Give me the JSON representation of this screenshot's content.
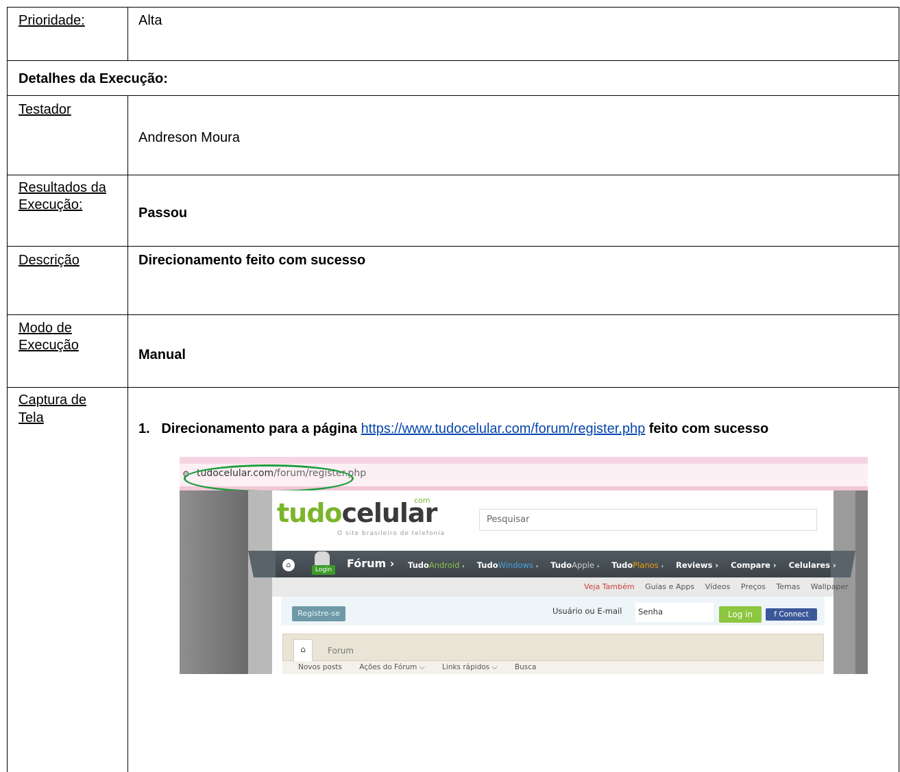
{
  "rows": {
    "prioridade": {
      "label": "Prioridade:",
      "value": "Alta"
    },
    "detalhes": {
      "title": "Detalhes da Execução:"
    },
    "testador": {
      "label": "Testador",
      "value": "Andreson Moura"
    },
    "resultados": {
      "label_1": "Resultados",
      "label_2": "da",
      "label_3": "Execução:",
      "value": "Passou"
    },
    "descricao": {
      "label": "Descrição",
      "value": "Direcionamento feito com sucesso"
    },
    "modo": {
      "label_1": "Modo de",
      "label_2": "Execução",
      "value": "Manual"
    },
    "captura": {
      "label_1": "Captura de",
      "label_2": "Tela",
      "step_number": "1.",
      "step_text_1": "Direcionamento para a página",
      "step_link": "https://www.tudocelular.com/forum/register.php",
      "step_text_2": "feito com sucesso"
    }
  },
  "screenshot": {
    "address_domain": "tudocelular.com",
    "address_path": "/forum/register.php",
    "logo_part1": "tudo",
    "logo_part2": "celular",
    "logo_com": "com",
    "logo_tagline": "O site brasileiro de telefonia",
    "search_placeholder": "Pesquisar",
    "login_tag": "Login",
    "nav_forum": "Fórum  ›",
    "nav": {
      "tudo": "Tudo",
      "android": "Android",
      "windows": "Windows",
      "apple": "Apple",
      "planos": "Planos",
      "reviews": "Reviews ›",
      "compare": "Compare ›",
      "celulares": "Celulares ›",
      "arrow": "›"
    },
    "subnav": [
      "Veja Também",
      "Guias e Apps",
      "Vídeos",
      "Preços",
      "Temas",
      "Wallpaper"
    ],
    "register_button": "Registre-se",
    "user_field": "Usuário ou E-mail",
    "password_field": "Senha",
    "login_button": "Log in",
    "connect_button": "f  Connect",
    "breadcrumb_forum": "Forum",
    "tabs": [
      "Novos posts",
      "Ações do Fórum ⌵",
      "Links rápidos ⌵",
      "Busca"
    ]
  },
  "colors": {
    "highlight_oval": "#1f9e3e",
    "link": "#0645ad",
    "brand_green": "#7bb52b"
  }
}
